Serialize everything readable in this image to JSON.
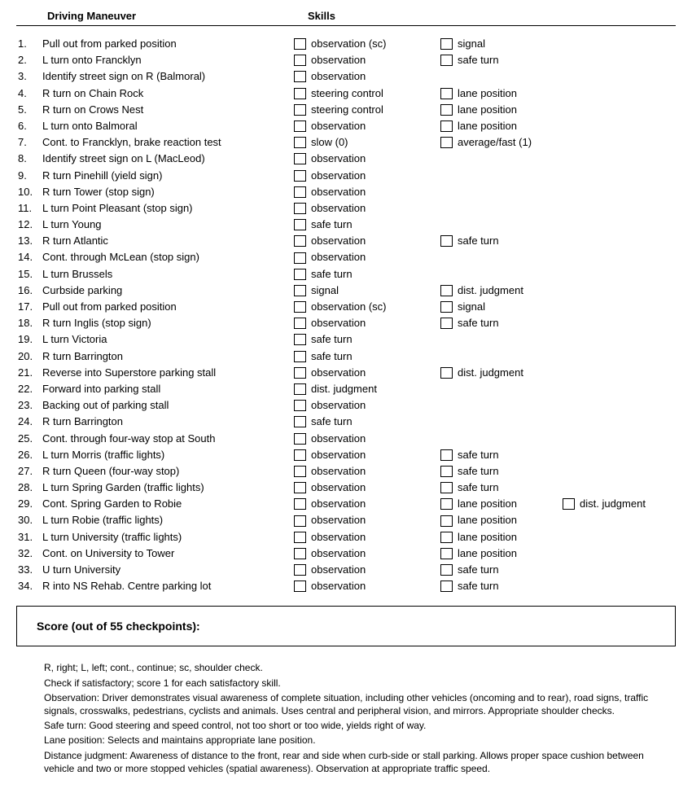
{
  "headers": {
    "maneuver": "Driving Maneuver",
    "skills": "Skills"
  },
  "rows": [
    {
      "n": "1.",
      "m": "Pull out from parked position",
      "s": [
        "observation (sc)",
        "signal"
      ]
    },
    {
      "n": "2.",
      "m": "L turn onto Francklyn",
      "s": [
        "observation",
        "safe turn"
      ]
    },
    {
      "n": "3.",
      "m": "Identify street sign on R (Balmoral)",
      "s": [
        "observation"
      ]
    },
    {
      "n": "4.",
      "m": "R turn on Chain Rock",
      "s": [
        "steering control",
        "lane position"
      ]
    },
    {
      "n": "5.",
      "m": "R turn on Crows Nest",
      "s": [
        "steering control",
        "lane position"
      ]
    },
    {
      "n": "6.",
      "m": "L turn onto Balmoral",
      "s": [
        "observation",
        "lane position"
      ]
    },
    {
      "n": "7.",
      "m": "Cont. to Francklyn, brake reaction test",
      "s": [
        "slow (0)",
        "average/fast (1)"
      ]
    },
    {
      "n": "8.",
      "m": "Identify street sign on L (MacLeod)",
      "s": [
        "observation"
      ]
    },
    {
      "n": "9.",
      "m": "R turn Pinehill (yield sign)",
      "s": [
        "observation"
      ]
    },
    {
      "n": "10.",
      "m": "R turn Tower (stop sign)",
      "s": [
        "observation"
      ]
    },
    {
      "n": "11.",
      "m": "L turn Point Pleasant (stop sign)",
      "s": [
        "observation"
      ]
    },
    {
      "n": "12.",
      "m": "L turn Young",
      "s": [
        "safe turn"
      ]
    },
    {
      "n": "13.",
      "m": "R turn Atlantic",
      "s": [
        "observation",
        "safe turn"
      ]
    },
    {
      "n": "14.",
      "m": "Cont. through McLean (stop sign)",
      "s": [
        "observation"
      ]
    },
    {
      "n": "15.",
      "m": "L turn Brussels",
      "s": [
        "safe turn"
      ]
    },
    {
      "n": "16.",
      "m": "Curbside parking",
      "s": [
        "signal",
        "dist. judgment"
      ]
    },
    {
      "n": "17.",
      "m": "Pull out from parked position",
      "s": [
        "observation (sc)",
        "signal"
      ]
    },
    {
      "n": "18.",
      "m": "R turn Inglis (stop sign)",
      "s": [
        "observation",
        "safe turn"
      ]
    },
    {
      "n": "19.",
      "m": "L turn Victoria",
      "s": [
        "safe turn"
      ]
    },
    {
      "n": "20.",
      "m": "R turn Barrington",
      "s": [
        "safe turn"
      ]
    },
    {
      "n": "21.",
      "m": "Reverse into Superstore parking stall",
      "s": [
        "observation",
        "dist. judgment"
      ]
    },
    {
      "n": "22.",
      "m": "Forward into parking stall",
      "s": [
        "dist. judgment"
      ]
    },
    {
      "n": "23.",
      "m": "Backing out of parking stall",
      "s": [
        "observation"
      ]
    },
    {
      "n": "24.",
      "m": "R turn Barrington",
      "s": [
        "safe turn"
      ]
    },
    {
      "n": "25.",
      "m": "Cont. through four-way stop at South",
      "s": [
        "observation"
      ]
    },
    {
      "n": "26.",
      "m": "L turn Morris (traffic lights)",
      "s": [
        "observation",
        "safe turn"
      ]
    },
    {
      "n": "27.",
      "m": "R turn Queen (four-way stop)",
      "s": [
        "observation",
        "safe turn"
      ]
    },
    {
      "n": "28.",
      "m": "L turn Spring Garden (traffic lights)",
      "s": [
        "observation",
        "safe turn"
      ]
    },
    {
      "n": "29.",
      "m": "Cont. Spring Garden to Robie",
      "s": [
        "observation",
        "lane position",
        "dist. judgment"
      ]
    },
    {
      "n": "30.",
      "m": "L turn Robie (traffic lights)",
      "s": [
        "observation",
        "lane position"
      ]
    },
    {
      "n": "31.",
      "m": "L turn University (traffic lights)",
      "s": [
        "observation",
        "lane position"
      ]
    },
    {
      "n": "32.",
      "m": "Cont. on University to Tower",
      "s": [
        "observation",
        "lane position"
      ]
    },
    {
      "n": "33.",
      "m": "U turn University",
      "s": [
        "observation",
        "safe turn"
      ]
    },
    {
      "n": "34.",
      "m": "R into NS Rehab. Centre parking lot",
      "s": [
        "observation",
        "safe turn"
      ]
    }
  ],
  "score_label": "Score (out of 55 checkpoints):",
  "notes": [
    "R, right; L, left; cont., continue; sc, shoulder check.",
    "Check if satisfactory; score 1 for each satisfactory skill.",
    "Observation: Driver demonstrates visual awareness of complete situation, including other vehicles (oncoming and to rear), road signs, traffic signals, crosswalks, pedestrians, cyclists and animals. Uses central and peripheral vision, and mirrors. Appropriate shoulder checks.",
    "Safe turn: Good steering and speed control, not too short or too wide, yields right of way.",
    "Lane position: Selects and maintains appropriate lane position.",
    "Distance judgment: Awareness of distance to the front, rear and side when curb-side or stall parking. Allows proper space cushion between vehicle and two or more stopped vehicles (spatial awareness). Observation at appropriate traffic speed."
  ]
}
